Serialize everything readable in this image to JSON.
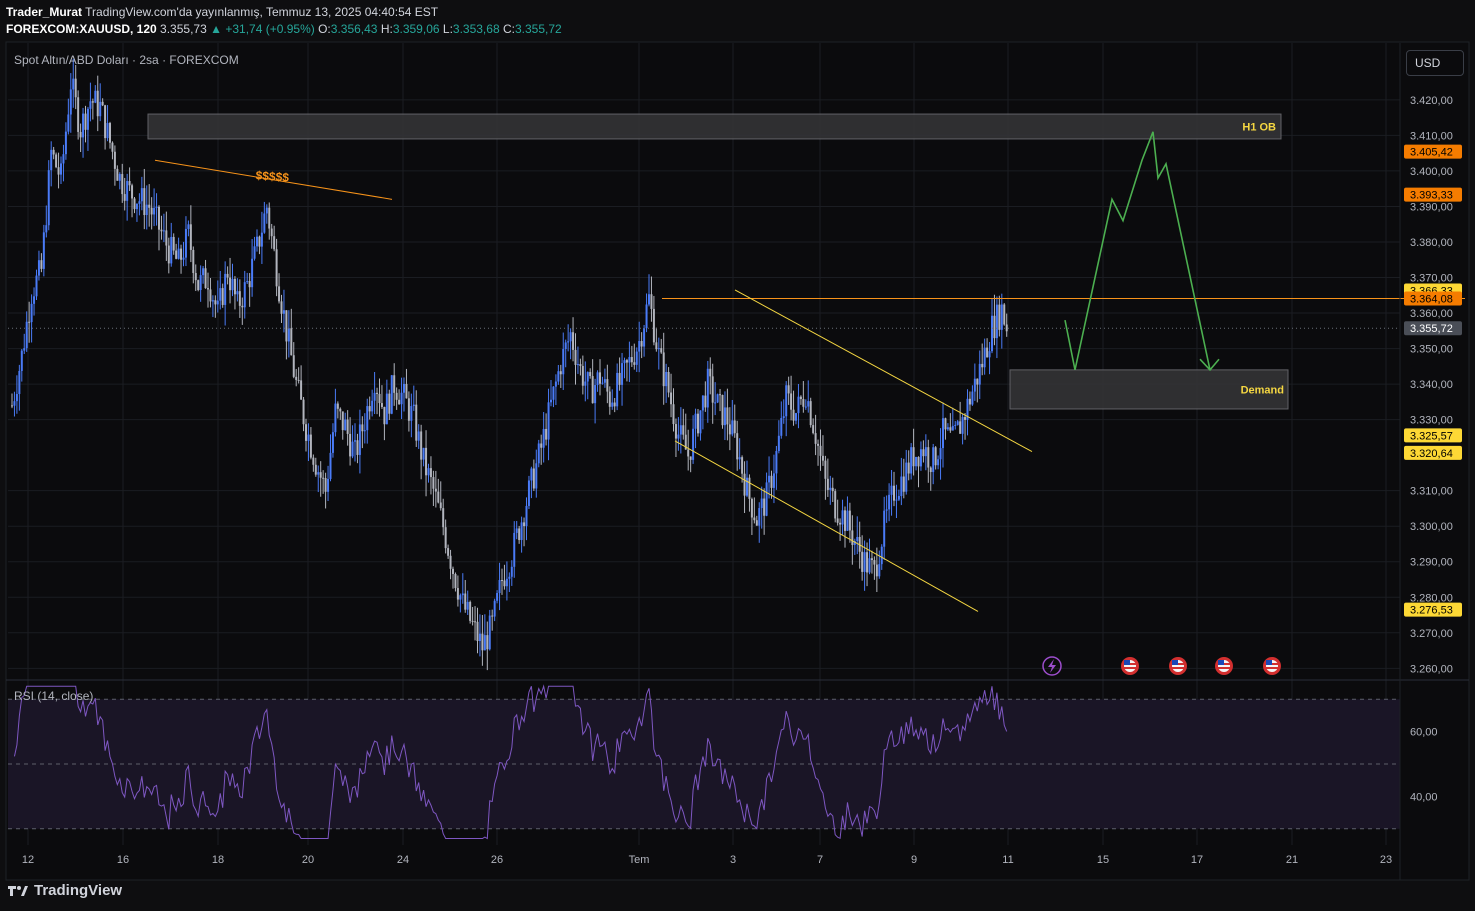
{
  "header": {
    "author": "Trader_Murat",
    "published_text": "TradingView.com'da yayınlanmış, Temmuz 13, 2025 04:40:54 EST",
    "symbol_line": "FOREXCOM:XAUUSD, 120",
    "last_price": "3.355,73",
    "change": "+31,74 (+0.95%)",
    "o_label": "O:",
    "o_value": "3.356,43",
    "h_label": "H:",
    "h_value": "3.359,06",
    "l_label": "L:",
    "l_value": "3.353,68",
    "c_label": "C:",
    "c_value": "3.355,72"
  },
  "pane": {
    "title": "Spot Altın/ABD Doları · 2sa · FOREXCOM",
    "currency_button": "USD",
    "rsi_title": "RSI (14, close)"
  },
  "footer": {
    "brand": "TradingView"
  },
  "colors": {
    "up": "#4a7bf7",
    "down": "#b2b5be",
    "orange": "#f7931a",
    "yellow": "#f5d742",
    "green": "#4caf50",
    "rsi": "#7e57c2",
    "grid": "#1b1d22",
    "zone": "#3a3a3e"
  },
  "chart_data": {
    "type": "candlestick",
    "y_axis": {
      "ticks": [
        3420,
        3410,
        3400,
        3390,
        3380,
        3370,
        3360,
        3350,
        3340,
        3330,
        3310,
        3300,
        3290,
        3280,
        3270,
        3260
      ],
      "tick_labels": [
        "3.420,00",
        "3.410,00",
        "3.400,00",
        "3.390,00",
        "3.380,00",
        "3.370,00",
        "3.360,00",
        "3.350,00",
        "3.340,00",
        "3.330,00",
        "3.310,00",
        "3.300,00",
        "3.290,00",
        "3.280,00",
        "3.270,00",
        "3.260,00"
      ],
      "range": [
        3257,
        3436
      ]
    },
    "x_axis": {
      "labels": [
        "12",
        "16",
        "18",
        "20",
        "24",
        "26",
        "Tem",
        "3",
        "7",
        "9",
        "11",
        "15",
        "17",
        "21",
        "23"
      ]
    },
    "price_labels": [
      {
        "value": 3405.42,
        "text": "3.405,42",
        "color": "#f57c00"
      },
      {
        "value": 3393.33,
        "text": "3.393,33",
        "color": "#f57c00"
      },
      {
        "value": 3366.33,
        "text": "3.366,33",
        "color": "#fdd835"
      },
      {
        "value": 3364.08,
        "text": "3.364,08",
        "color": "#f57c00"
      },
      {
        "value": 3355.72,
        "text": "3.355,72",
        "color": "#4a4e57"
      },
      {
        "value": 3325.57,
        "text": "3.325,57",
        "color": "#fdd835"
      },
      {
        "value": 3320.64,
        "text": "3.320,64",
        "color": "#fdd835"
      },
      {
        "value": 3276.53,
        "text": "3.276,53",
        "color": "#fdd835"
      }
    ],
    "path": [
      [
        0,
        3334
      ],
      [
        4,
        3348
      ],
      [
        8,
        3366
      ],
      [
        12,
        3372
      ],
      [
        16,
        3405
      ],
      [
        20,
        3398
      ],
      [
        24,
        3425
      ],
      [
        28,
        3412
      ],
      [
        32,
        3420
      ],
      [
        36,
        3418
      ],
      [
        40,
        3408
      ],
      [
        44,
        3398
      ],
      [
        48,
        3394
      ],
      [
        52,
        3392
      ],
      [
        56,
        3390
      ],
      [
        60,
        3384
      ],
      [
        64,
        3378
      ],
      [
        68,
        3374
      ],
      [
        72,
        3382
      ],
      [
        76,
        3368
      ],
      [
        80,
        3370
      ],
      [
        84,
        3360
      ],
      [
        88,
        3372
      ],
      [
        92,
        3362
      ],
      [
        96,
        3368
      ],
      [
        100,
        3378
      ],
      [
        104,
        3390
      ],
      [
        108,
        3372
      ],
      [
        112,
        3355
      ],
      [
        116,
        3340
      ],
      [
        120,
        3328
      ],
      [
        124,
        3318
      ],
      [
        128,
        3310
      ],
      [
        132,
        3332
      ],
      [
        136,
        3328
      ],
      [
        140,
        3320
      ],
      [
        144,
        3330
      ],
      [
        148,
        3342
      ],
      [
        152,
        3332
      ],
      [
        156,
        3340
      ],
      [
        160,
        3336
      ],
      [
        164,
        3330
      ],
      [
        168,
        3318
      ],
      [
        172,
        3310
      ],
      [
        176,
        3300
      ],
      [
        180,
        3288
      ],
      [
        184,
        3278
      ],
      [
        188,
        3272
      ],
      [
        192,
        3266
      ],
      [
        196,
        3272
      ],
      [
        200,
        3285
      ],
      [
        204,
        3292
      ],
      [
        208,
        3302
      ],
      [
        212,
        3312
      ],
      [
        216,
        3322
      ],
      [
        220,
        3334
      ],
      [
        224,
        3346
      ],
      [
        228,
        3354
      ],
      [
        232,
        3344
      ],
      [
        236,
        3338
      ],
      [
        240,
        3342
      ],
      [
        244,
        3336
      ],
      [
        248,
        3340
      ],
      [
        252,
        3346
      ],
      [
        256,
        3352
      ],
      [
        260,
        3364
      ],
      [
        264,
        3348
      ],
      [
        268,
        3338
      ],
      [
        272,
        3326
      ],
      [
        276,
        3320
      ],
      [
        280,
        3330
      ],
      [
        284,
        3340
      ],
      [
        288,
        3334
      ],
      [
        292,
        3330
      ],
      [
        296,
        3322
      ],
      [
        300,
        3310
      ],
      [
        304,
        3302
      ],
      [
        308,
        3308
      ],
      [
        312,
        3320
      ],
      [
        316,
        3336
      ],
      [
        320,
        3332
      ],
      [
        324,
        3338
      ],
      [
        328,
        3326
      ],
      [
        332,
        3312
      ],
      [
        336,
        3306
      ],
      [
        340,
        3302
      ],
      [
        344,
        3296
      ],
      [
        348,
        3290
      ],
      [
        352,
        3287
      ],
      [
        356,
        3300
      ],
      [
        360,
        3310
      ],
      [
        364,
        3314
      ],
      [
        368,
        3320
      ],
      [
        372,
        3322
      ],
      [
        376,
        3318
      ],
      [
        380,
        3326
      ],
      [
        384,
        3324
      ],
      [
        388,
        3330
      ],
      [
        392,
        3338
      ],
      [
        396,
        3346
      ],
      [
        400,
        3356
      ],
      [
        404,
        3361
      ],
      [
        406,
        3356
      ]
    ],
    "rsi": {
      "ticks": [
        60,
        40
      ],
      "tick_labels": [
        "60,00",
        "40,00"
      ],
      "overbought": 70,
      "oversold": 30,
      "mid": 50,
      "range": [
        25,
        75
      ]
    },
    "annotations": {
      "h1_ob_label": "H1 OB",
      "demand_label": "Demand",
      "liquidity_label": "$$$$$"
    }
  }
}
